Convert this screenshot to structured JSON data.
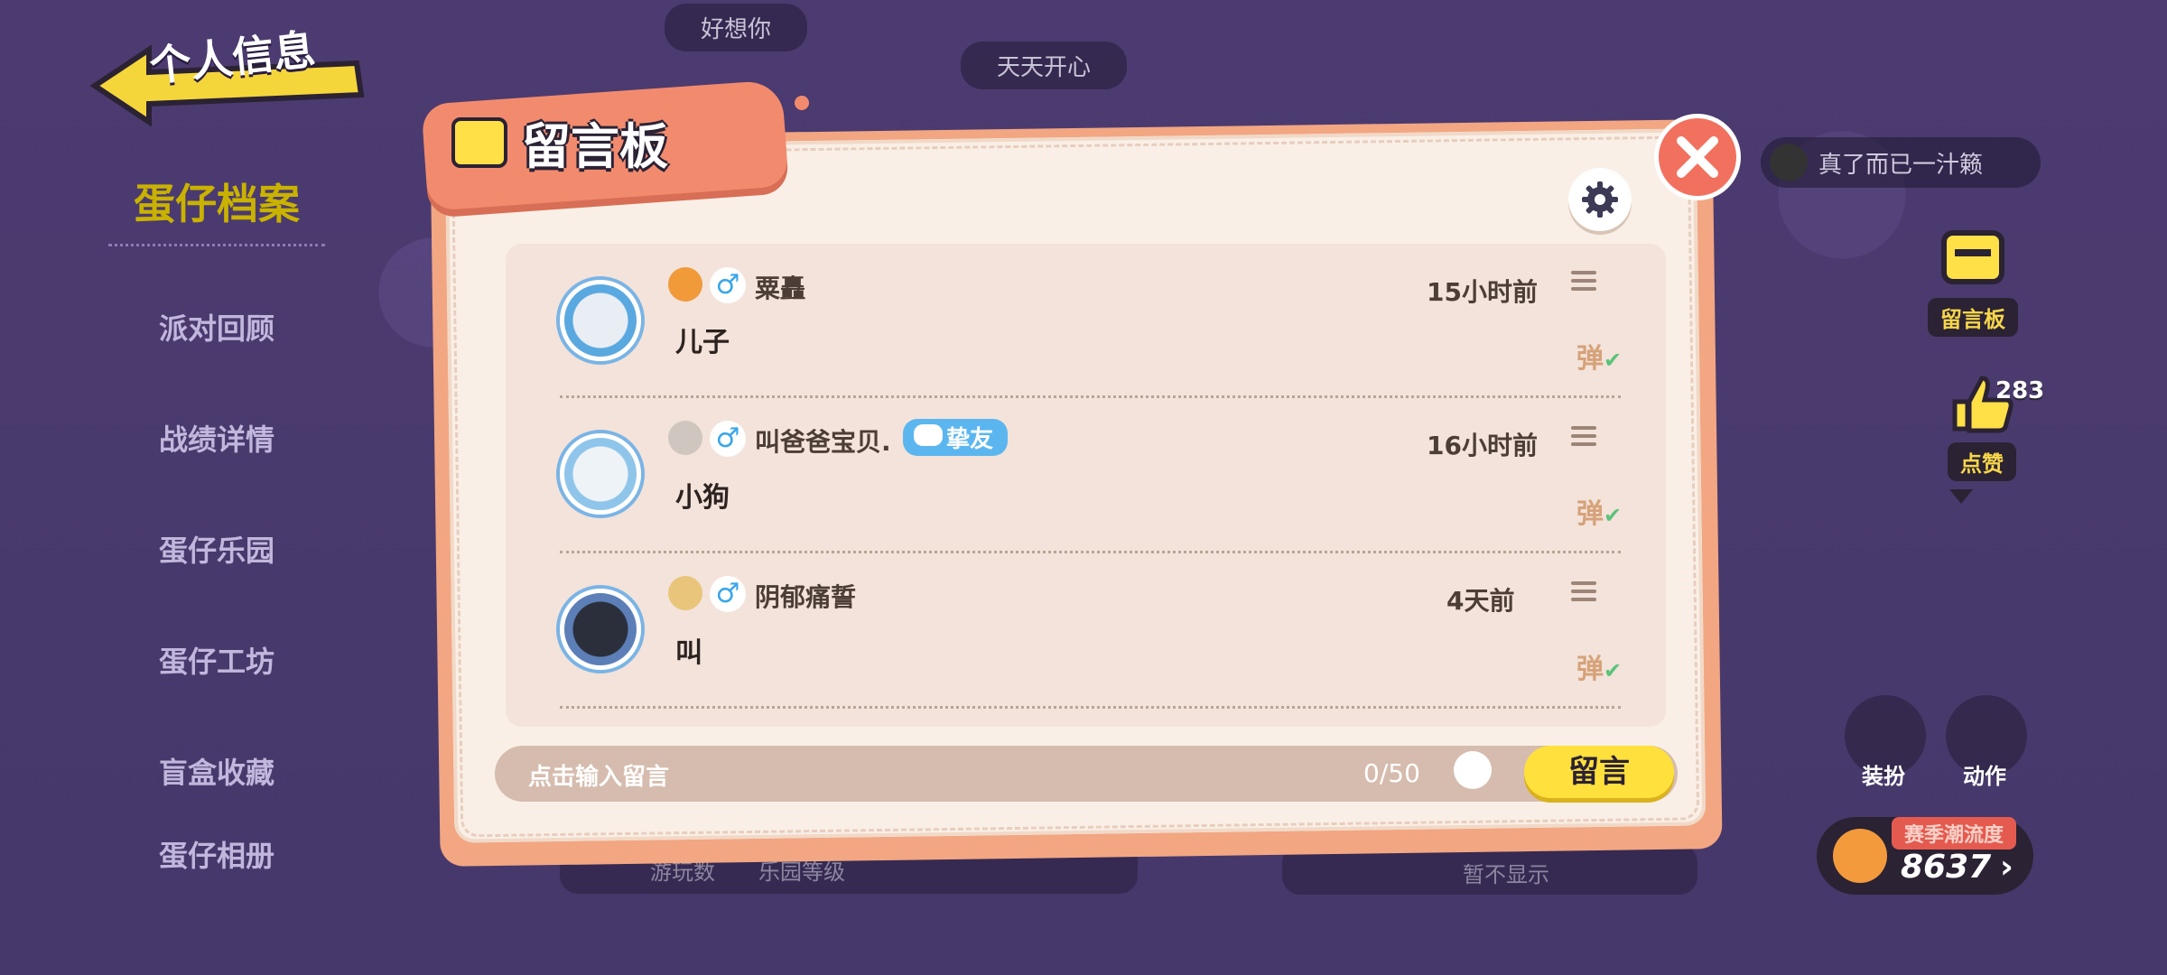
{
  "header": {
    "back_label": "个人信息"
  },
  "top_chips": [
    "好想你",
    "天天开心"
  ],
  "left_nav": {
    "title": "蛋仔档案",
    "items": [
      "派对回顾",
      "战绩详情",
      "蛋仔乐园",
      "蛋仔工坊",
      "盲盒收藏",
      "蛋仔相册"
    ]
  },
  "right_panel": {
    "user_chip": "真了而已一汁籁",
    "message_board_label": "留言板",
    "like_label": "点赞",
    "like_count": "283",
    "dress_label": "装扮",
    "action_label": "动作",
    "heat_label": "赛季潮流度",
    "heat_value": "8637"
  },
  "dialog": {
    "title": "留言板",
    "messages": [
      {
        "username": "粟矗",
        "gender": "♂",
        "text": "儿子",
        "time": "15小时前",
        "tag": "",
        "danmu": "弹"
      },
      {
        "username": "叫爸爸宝贝.",
        "gender": "♂",
        "text": "小狗",
        "time": "16小时前",
        "tag": "挚友",
        "danmu": "弹"
      },
      {
        "username": "阴郁痛誓",
        "gender": "♂",
        "text": "叫",
        "time": "4天前",
        "tag": "",
        "danmu": "弹"
      }
    ],
    "input": {
      "placeholder": "点击输入留言",
      "counter": "0/50"
    },
    "send_label": "留言"
  },
  "background_bar": {
    "items": [
      "游玩数",
      "乐园等级",
      "暂不显示"
    ]
  },
  "colors": {
    "accent": "#f28b6e",
    "send": "#ffe03c",
    "friend_tag": "#5bb6f0"
  }
}
